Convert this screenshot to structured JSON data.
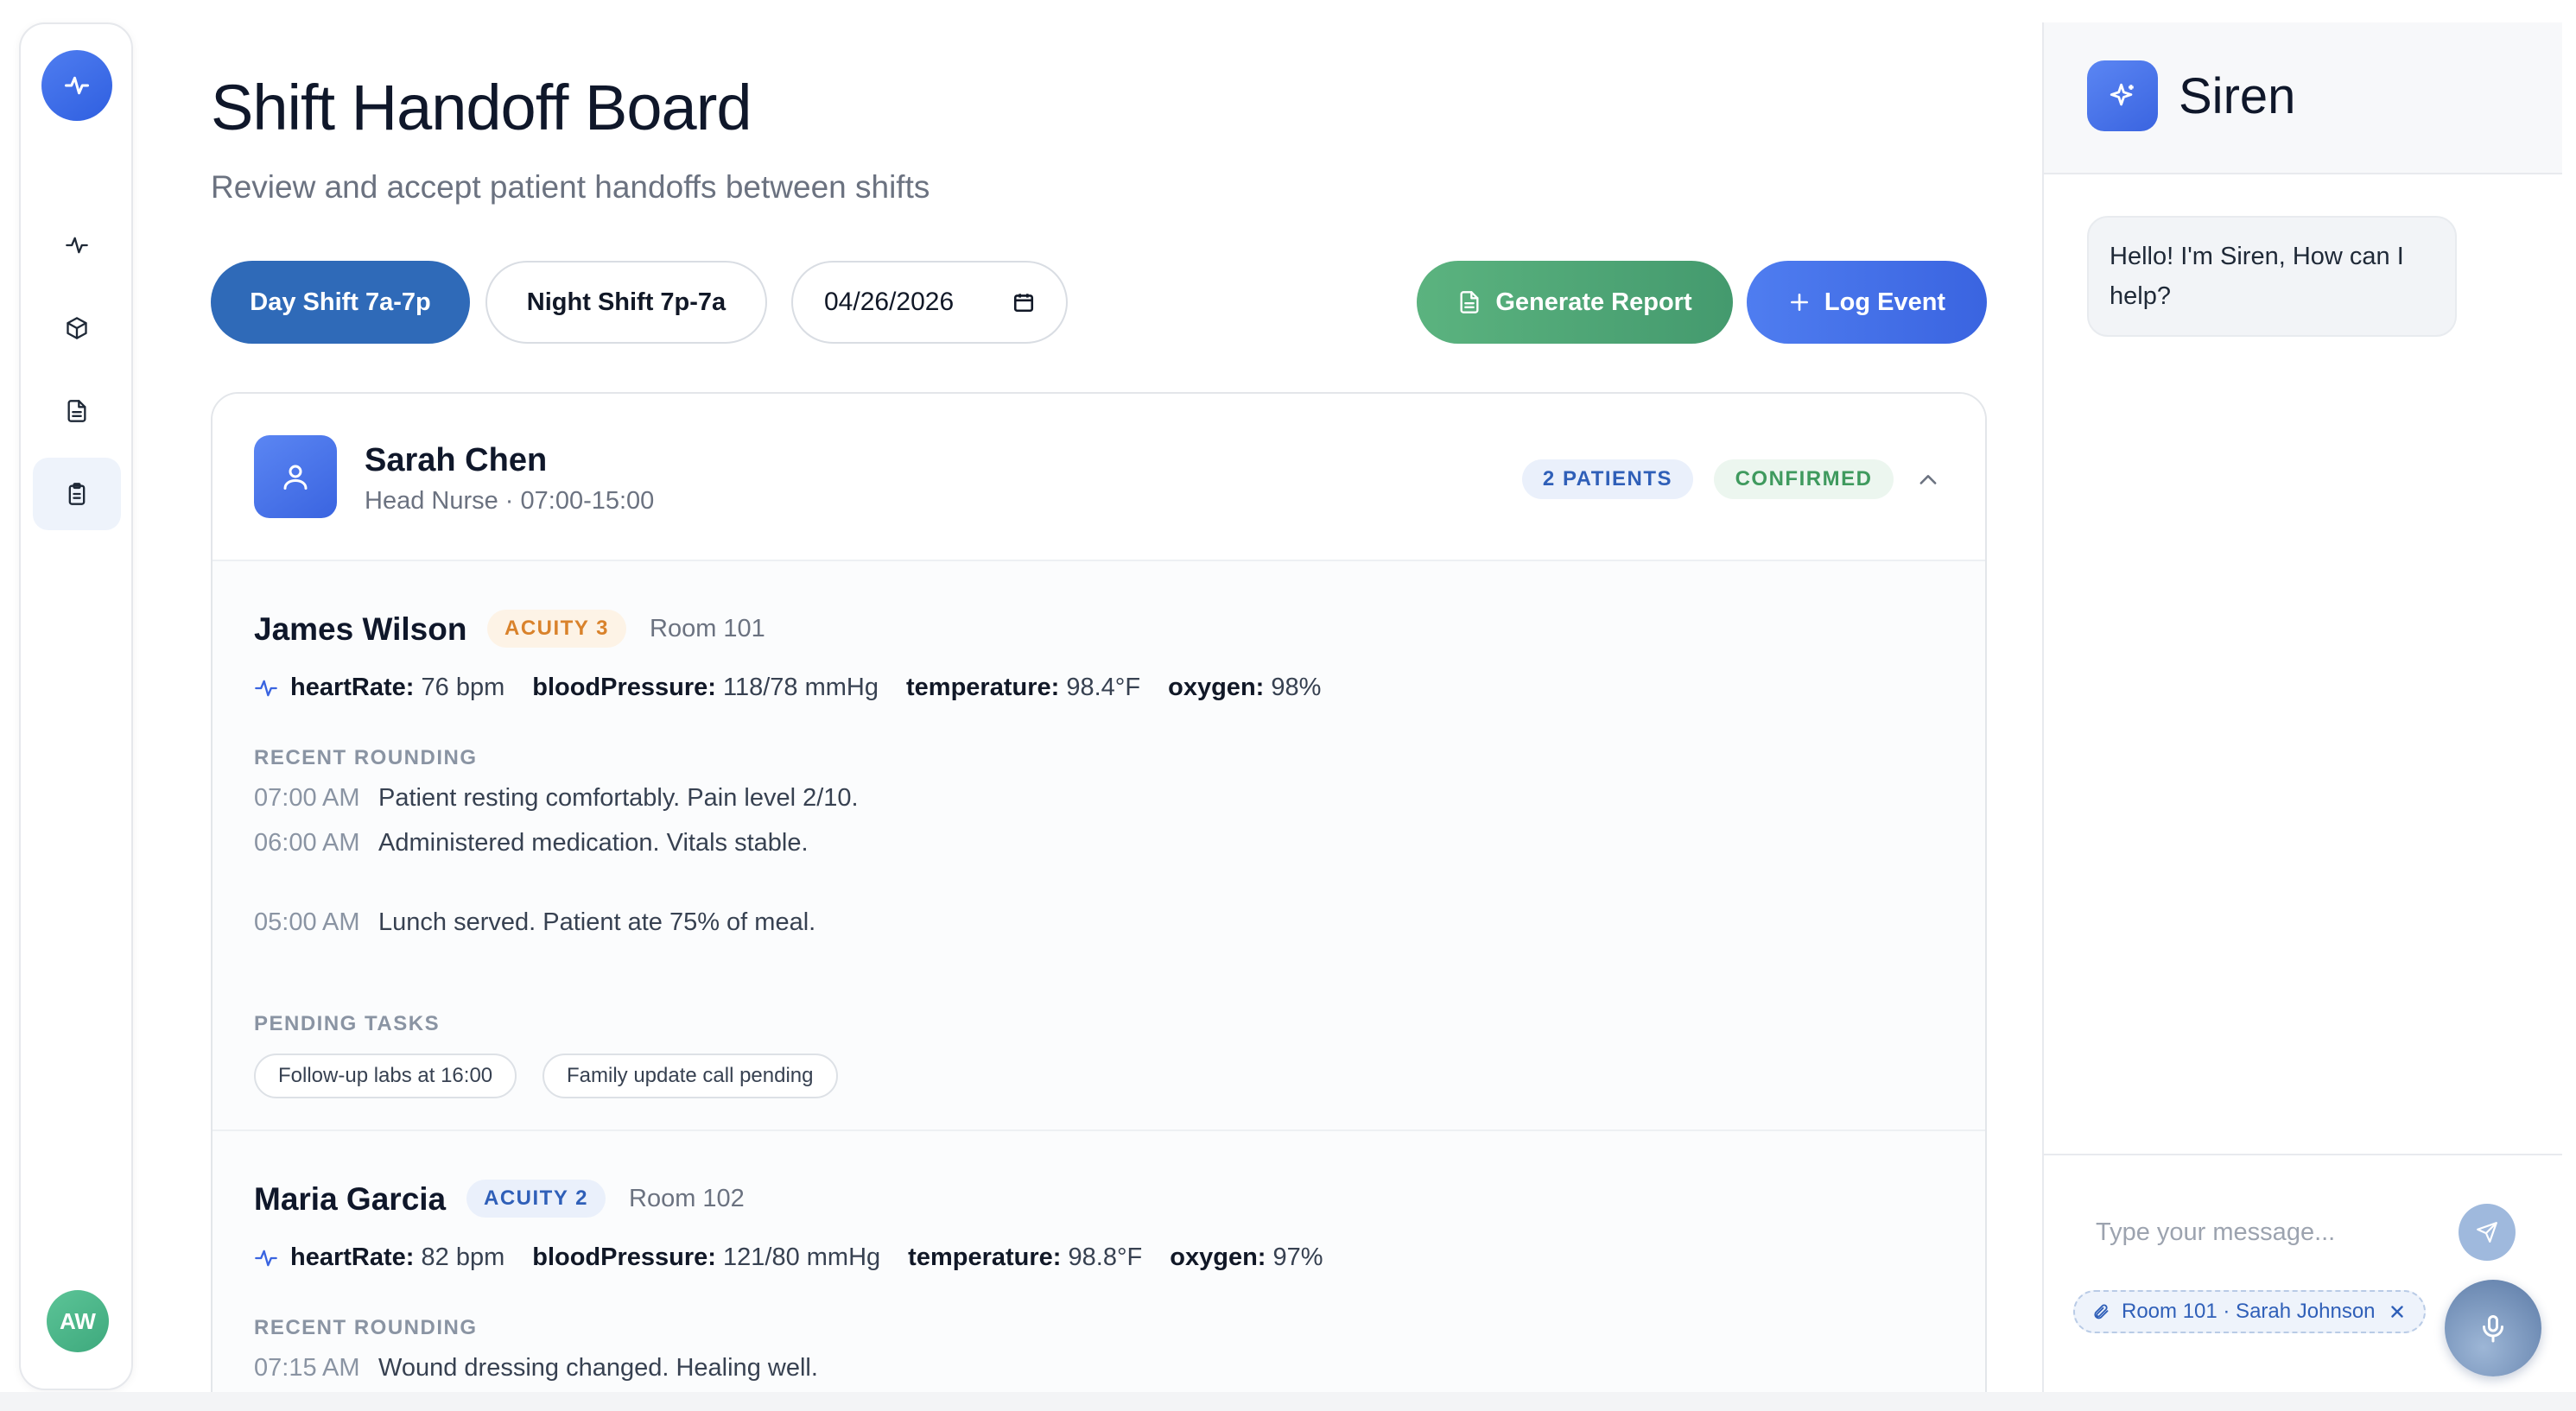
{
  "rail": {
    "items": [
      "activity",
      "package",
      "document",
      "clipboard"
    ],
    "avatar_initials": "AW"
  },
  "header": {
    "title": "Shift Handoff Board",
    "subtitle": "Review and accept patient handoffs between shifts"
  },
  "toolbar": {
    "day_shift_label": "Day Shift 7a-7p",
    "night_shift_label": "Night Shift 7p-7a",
    "date_value": "2026-04-26",
    "report_label": "Generate Report",
    "log_event_label": "Log Event"
  },
  "nurse": {
    "name": "Sarah Chen",
    "role": "Head Nurse · 07:00-15:00",
    "patients_badge": "2 PATIENTS",
    "status_badge": "CONFIRMED",
    "status_color": "#3f9a5e"
  },
  "patients": [
    {
      "name": "James Wilson",
      "acuity": "ACUITY 3",
      "room": "Room 101",
      "vitals": [
        {
          "label": "heartRate:",
          "value": "76 bpm"
        },
        {
          "label": "bloodPressure:",
          "value": "118/78 mmHg"
        },
        {
          "label": "temperature:",
          "value": "98.4°F"
        },
        {
          "label": "oxygen:",
          "value": "98%"
        }
      ],
      "rounding_label": "RECENT ROUNDING",
      "rounding": [
        {
          "time": "07:00 AM",
          "note": "Patient resting comfortably. Pain level 2/10."
        },
        {
          "time": "06:00 AM",
          "note": "Administered medication. Vitals stable."
        },
        {
          "time": "05:00 AM",
          "note": "Lunch served. Patient ate 75% of meal."
        }
      ],
      "tasks_label": "PENDING TASKS",
      "tasks": [
        "Follow-up labs at 16:00",
        "Family update call pending"
      ]
    },
    {
      "name": "Maria Garcia",
      "acuity": "ACUITY 2",
      "room": "Room 102",
      "vitals": [
        {
          "label": "heartRate:",
          "value": "82 bpm"
        },
        {
          "label": "bloodPressure:",
          "value": "121/80 mmHg"
        },
        {
          "label": "temperature:",
          "value": "98.8°F"
        },
        {
          "label": "oxygen:",
          "value": "97%"
        }
      ],
      "rounding_label": "RECENT ROUNDING",
      "rounding": [
        {
          "time": "07:15 AM",
          "note": "Wound dressing changed. Healing well."
        }
      ]
    }
  ],
  "chat": {
    "title": "Siren",
    "greeting": "Hello! I'm Siren, How can I help?",
    "input_placeholder": "Type your message...",
    "context_chip": "Room 101 · Sarah Johnson"
  },
  "colors": {
    "primary": "#3a64e0",
    "day_shift": "#2f6ab8",
    "report": "#4aa373",
    "acuity3": "#d9822b",
    "acuity2": "#2f5fb8"
  }
}
